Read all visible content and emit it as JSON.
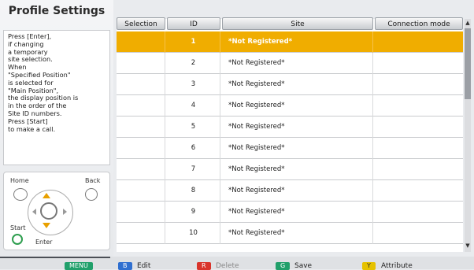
{
  "title": "Profile Settings",
  "help_text": "Press [Enter],\nif changing\na temporary\nsite selection.\nWhen\n\"Specified Position\"\nis selected for\n\"Main Position\",\nthe display position is\nin the order of the\nSite ID numbers.\nPress [Start]\nto make a call.",
  "remote": {
    "home_label": "Home",
    "back_label": "Back",
    "start_label": "Start",
    "enter_label": "Enter"
  },
  "table": {
    "headers": [
      "Selection",
      "ID",
      "Site",
      "Connection mode"
    ],
    "rows": [
      {
        "selection": "",
        "id": "1",
        "site": "*Not Registered*",
        "mode": ""
      },
      {
        "selection": "",
        "id": "2",
        "site": "*Not Registered*",
        "mode": ""
      },
      {
        "selection": "",
        "id": "3",
        "site": "*Not Registered*",
        "mode": ""
      },
      {
        "selection": "",
        "id": "4",
        "site": "*Not Registered*",
        "mode": ""
      },
      {
        "selection": "",
        "id": "5",
        "site": "*Not Registered*",
        "mode": ""
      },
      {
        "selection": "",
        "id": "6",
        "site": "*Not Registered*",
        "mode": ""
      },
      {
        "selection": "",
        "id": "7",
        "site": "*Not Registered*",
        "mode": ""
      },
      {
        "selection": "",
        "id": "8",
        "site": "*Not Registered*",
        "mode": ""
      },
      {
        "selection": "",
        "id": "9",
        "site": "*Not Registered*",
        "mode": ""
      },
      {
        "selection": "",
        "id": "10",
        "site": "*Not Registered*",
        "mode": ""
      }
    ]
  },
  "footer": {
    "menu_key": "MENU",
    "edit_key": "B",
    "edit_label": "Edit",
    "delete_key": "R",
    "delete_label": "Delete",
    "save_key": "G",
    "save_label": "Save",
    "attribute_key": "Y",
    "attribute_label": "Attribute"
  },
  "colors": {
    "selected_row": "#f0ad00",
    "key_blue": "#2f6fd0",
    "key_red": "#d9342b",
    "key_green": "#21a06b",
    "key_yellow": "#e6c200"
  },
  "icons": {
    "up_arrow": "triangle-up",
    "down_arrow": "triangle-down"
  }
}
